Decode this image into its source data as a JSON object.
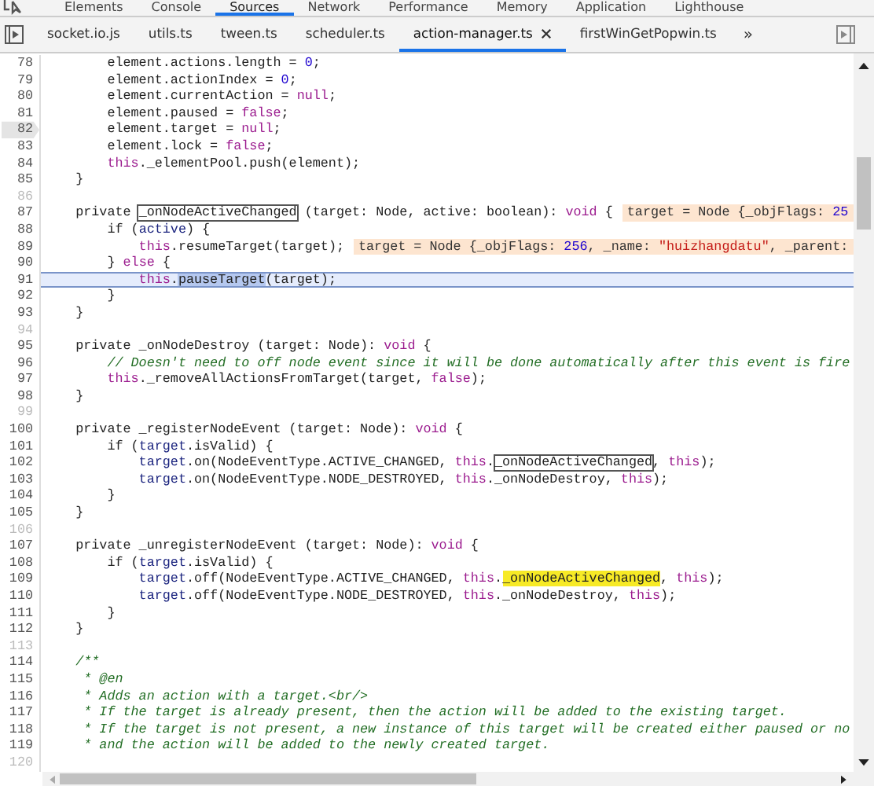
{
  "devtools_tabs": [
    {
      "label": "Elements",
      "selected": false
    },
    {
      "label": "Console",
      "selected": false
    },
    {
      "label": "Sources",
      "selected": true
    },
    {
      "label": "Network",
      "selected": false
    },
    {
      "label": "Performance",
      "selected": false
    },
    {
      "label": "Memory",
      "selected": false
    },
    {
      "label": "Application",
      "selected": false
    },
    {
      "label": "Lighthouse",
      "selected": false
    }
  ],
  "file_tabs": [
    {
      "label": "socket.io.js",
      "selected": false
    },
    {
      "label": "utils.ts",
      "selected": false
    },
    {
      "label": "tween.ts",
      "selected": false
    },
    {
      "label": "scheduler.ts",
      "selected": false
    },
    {
      "label": "action-manager.ts",
      "selected": true
    },
    {
      "label": "firstWinGetPopwin.ts",
      "selected": false
    }
  ],
  "more_tabs": "»",
  "lines": [
    {
      "number": "78",
      "breakpoint": false,
      "current": false,
      "tokens": [
        {
          "kind": "plain",
          "text": "        element.actions.length = "
        },
        {
          "kind": "number",
          "text": "0"
        },
        {
          "kind": "plain",
          "text": ";"
        }
      ]
    },
    {
      "number": "79",
      "breakpoint": false,
      "current": false,
      "tokens": [
        {
          "kind": "plain",
          "text": "        element.actionIndex = "
        },
        {
          "kind": "number",
          "text": "0"
        },
        {
          "kind": "plain",
          "text": ";"
        }
      ]
    },
    {
      "number": "80",
      "breakpoint": false,
      "current": false,
      "tokens": [
        {
          "kind": "plain",
          "text": "        element.currentAction = "
        },
        {
          "kind": "keyword",
          "text": "null"
        },
        {
          "kind": "plain",
          "text": ";"
        }
      ]
    },
    {
      "number": "81",
      "breakpoint": false,
      "current": false,
      "tokens": [
        {
          "kind": "plain",
          "text": "        element.paused = "
        },
        {
          "kind": "keyword",
          "text": "false"
        },
        {
          "kind": "plain",
          "text": ";"
        }
      ]
    },
    {
      "number": "82",
      "breakpoint": true,
      "current": false,
      "tokens": [
        {
          "kind": "plain",
          "text": "        element.target = "
        },
        {
          "kind": "keyword",
          "text": "null"
        },
        {
          "kind": "plain",
          "text": ";"
        }
      ]
    },
    {
      "number": "83",
      "breakpoint": false,
      "current": false,
      "tokens": [
        {
          "kind": "plain",
          "text": "        element.lock = "
        },
        {
          "kind": "keyword",
          "text": "false"
        },
        {
          "kind": "plain",
          "text": ";"
        }
      ]
    },
    {
      "number": "84",
      "breakpoint": false,
      "current": false,
      "tokens": [
        {
          "kind": "keyword",
          "text": "        this"
        },
        {
          "kind": "plain",
          "text": "._elementPool.push(element);"
        }
      ]
    },
    {
      "number": "85",
      "breakpoint": false,
      "current": false,
      "tokens": [
        {
          "kind": "plain",
          "text": "    }"
        }
      ]
    },
    {
      "number": "86",
      "breakpoint": false,
      "current": false
    },
    {
      "number": "87",
      "breakpoint": false,
      "current": false,
      "tokens": [
        {
          "kind": "plain",
          "text": "    private "
        },
        {
          "kind": "boxed",
          "text": "_onNodeActiveChanged"
        },
        {
          "kind": "plain",
          "text": " (target: Node, active: boolean): "
        },
        {
          "kind": "keyword",
          "text": "void"
        },
        {
          "kind": "plain",
          "text": " {"
        }
      ],
      "inline_value": [
        {
          "kind": "plain",
          "text": "target = Node {_objFlags: "
        },
        {
          "kind": "number",
          "text": "25"
        }
      ]
    },
    {
      "number": "88",
      "breakpoint": false,
      "current": false,
      "tokens": [
        {
          "kind": "plain",
          "text": "        if ("
        },
        {
          "kind": "var",
          "text": "active"
        },
        {
          "kind": "plain",
          "text": ") {"
        }
      ]
    },
    {
      "number": "89",
      "breakpoint": false,
      "current": false,
      "tokens": [
        {
          "kind": "keyword",
          "text": "            this"
        },
        {
          "kind": "plain",
          "text": ".resumeTarget(target);"
        }
      ],
      "inline_value": [
        {
          "kind": "plain",
          "text": "target = Node {_objFlags: "
        },
        {
          "kind": "number",
          "text": "256"
        },
        {
          "kind": "plain",
          "text": ", _name: "
        },
        {
          "kind": "string",
          "text": "\"huizhangdatu\""
        },
        {
          "kind": "plain",
          "text": ", _parent:"
        }
      ]
    },
    {
      "number": "90",
      "breakpoint": false,
      "current": false,
      "tokens": [
        {
          "kind": "plain",
          "text": "        } "
        },
        {
          "kind": "keyword",
          "text": "else"
        },
        {
          "kind": "plain",
          "text": " {"
        }
      ]
    },
    {
      "number": "91",
      "breakpoint": false,
      "current": true,
      "tokens": [
        {
          "kind": "keyword",
          "text": "            this"
        },
        {
          "kind": "plain",
          "text": "."
        },
        {
          "kind": "selection",
          "text": "pauseTarget"
        },
        {
          "kind": "plain",
          "text": "(target);"
        }
      ]
    },
    {
      "number": "92",
      "breakpoint": false,
      "current": false,
      "tokens": [
        {
          "kind": "plain",
          "text": "        }"
        }
      ]
    },
    {
      "number": "93",
      "breakpoint": false,
      "current": false,
      "tokens": [
        {
          "kind": "plain",
          "text": "    }"
        }
      ]
    },
    {
      "number": "94",
      "breakpoint": false,
      "current": false
    },
    {
      "number": "95",
      "breakpoint": false,
      "current": false,
      "tokens": [
        {
          "kind": "plain",
          "text": "    private _onNodeDestroy (target: Node): "
        },
        {
          "kind": "keyword",
          "text": "void"
        },
        {
          "kind": "plain",
          "text": " {"
        }
      ]
    },
    {
      "number": "96",
      "breakpoint": false,
      "current": false,
      "tokens": [
        {
          "kind": "comment",
          "text": "        // Doesn't need to off node event since it will be done automatically after this event is fire"
        }
      ]
    },
    {
      "number": "97",
      "breakpoint": false,
      "current": false,
      "tokens": [
        {
          "kind": "keyword",
          "text": "        this"
        },
        {
          "kind": "plain",
          "text": "._removeAllActionsFromTarget(target, "
        },
        {
          "kind": "keyword",
          "text": "false"
        },
        {
          "kind": "plain",
          "text": ");"
        }
      ]
    },
    {
      "number": "98",
      "breakpoint": false,
      "current": false,
      "tokens": [
        {
          "kind": "plain",
          "text": "    }"
        }
      ]
    },
    {
      "number": "99",
      "breakpoint": false,
      "current": false
    },
    {
      "number": "100",
      "breakpoint": false,
      "current": false,
      "tokens": [
        {
          "kind": "plain",
          "text": "    private _registerNodeEvent (target: Node): "
        },
        {
          "kind": "keyword",
          "text": "void"
        },
        {
          "kind": "plain",
          "text": " {"
        }
      ]
    },
    {
      "number": "101",
      "breakpoint": false,
      "current": false,
      "tokens": [
        {
          "kind": "plain",
          "text": "        if ("
        },
        {
          "kind": "var",
          "text": "target"
        },
        {
          "kind": "plain",
          "text": ".isValid) {"
        }
      ]
    },
    {
      "number": "102",
      "breakpoint": false,
      "current": false,
      "tokens": [
        {
          "kind": "var",
          "text": "            target"
        },
        {
          "kind": "plain",
          "text": ".on(NodeEventType.ACTIVE_CHANGED, "
        },
        {
          "kind": "keyword",
          "text": "this"
        },
        {
          "kind": "plain",
          "text": "."
        },
        {
          "kind": "boxed",
          "text": "_onNodeActiveChanged"
        },
        {
          "kind": "plain",
          "text": ", "
        },
        {
          "kind": "keyword",
          "text": "this"
        },
        {
          "kind": "plain",
          "text": ");"
        }
      ]
    },
    {
      "number": "103",
      "breakpoint": false,
      "current": false,
      "tokens": [
        {
          "kind": "var",
          "text": "            target"
        },
        {
          "kind": "plain",
          "text": ".on(NodeEventType.NODE_DESTROYED, "
        },
        {
          "kind": "keyword",
          "text": "this"
        },
        {
          "kind": "plain",
          "text": "._onNodeDestroy, "
        },
        {
          "kind": "keyword",
          "text": "this"
        },
        {
          "kind": "plain",
          "text": ");"
        }
      ]
    },
    {
      "number": "104",
      "breakpoint": false,
      "current": false,
      "tokens": [
        {
          "kind": "plain",
          "text": "        }"
        }
      ]
    },
    {
      "number": "105",
      "breakpoint": false,
      "current": false,
      "tokens": [
        {
          "kind": "plain",
          "text": "    }"
        }
      ]
    },
    {
      "number": "106",
      "breakpoint": false,
      "current": false
    },
    {
      "number": "107",
      "breakpoint": false,
      "current": false,
      "tokens": [
        {
          "kind": "plain",
          "text": "    private _unregisterNodeEvent (target: Node): "
        },
        {
          "kind": "keyword",
          "text": "void"
        },
        {
          "kind": "plain",
          "text": " {"
        }
      ]
    },
    {
      "number": "108",
      "breakpoint": false,
      "current": false,
      "tokens": [
        {
          "kind": "plain",
          "text": "        if ("
        },
        {
          "kind": "var",
          "text": "target"
        },
        {
          "kind": "plain",
          "text": ".isValid) {"
        }
      ]
    },
    {
      "number": "109",
      "breakpoint": false,
      "current": false,
      "tokens": [
        {
          "kind": "var",
          "text": "            target"
        },
        {
          "kind": "plain",
          "text": ".off(NodeEventType.ACTIVE_CHANGED, "
        },
        {
          "kind": "keyword",
          "text": "this"
        },
        {
          "kind": "plain",
          "text": "."
        },
        {
          "kind": "match",
          "text": "_onNodeActiveChanged"
        },
        {
          "kind": "plain",
          "text": ", "
        },
        {
          "kind": "keyword",
          "text": "this"
        },
        {
          "kind": "plain",
          "text": ");"
        }
      ]
    },
    {
      "number": "110",
      "breakpoint": false,
      "current": false,
      "tokens": [
        {
          "kind": "var",
          "text": "            target"
        },
        {
          "kind": "plain",
          "text": ".off(NodeEventType.NODE_DESTROYED, "
        },
        {
          "kind": "keyword",
          "text": "this"
        },
        {
          "kind": "plain",
          "text": "._onNodeDestroy, "
        },
        {
          "kind": "keyword",
          "text": "this"
        },
        {
          "kind": "plain",
          "text": ");"
        }
      ]
    },
    {
      "number": "111",
      "breakpoint": false,
      "current": false,
      "tokens": [
        {
          "kind": "plain",
          "text": "        }"
        }
      ]
    },
    {
      "number": "112",
      "breakpoint": false,
      "current": false,
      "tokens": [
        {
          "kind": "plain",
          "text": "    }"
        }
      ]
    },
    {
      "number": "113",
      "breakpoint": false,
      "current": false
    },
    {
      "number": "114",
      "breakpoint": false,
      "current": false,
      "tokens": [
        {
          "kind": "comment",
          "text": "    /**"
        }
      ]
    },
    {
      "number": "115",
      "breakpoint": false,
      "current": false,
      "tokens": [
        {
          "kind": "comment",
          "text": "     * @en"
        }
      ]
    },
    {
      "number": "116",
      "breakpoint": false,
      "current": false,
      "tokens": [
        {
          "kind": "comment",
          "text": "     * Adds an action with a target.<br/>"
        }
      ]
    },
    {
      "number": "117",
      "breakpoint": false,
      "current": false,
      "tokens": [
        {
          "kind": "comment",
          "text": "     * If the target is already present, then the action will be added to the existing target."
        }
      ]
    },
    {
      "number": "118",
      "breakpoint": false,
      "current": false,
      "tokens": [
        {
          "kind": "comment",
          "text": "     * If the target is not present, a new instance of this target will be created either paused or no"
        }
      ]
    },
    {
      "number": "119",
      "breakpoint": false,
      "current": false,
      "tokens": [
        {
          "kind": "comment",
          "text": "     * and the action will be added to the newly created target."
        }
      ]
    },
    {
      "number": "120",
      "breakpoint": false,
      "current": false
    }
  ]
}
